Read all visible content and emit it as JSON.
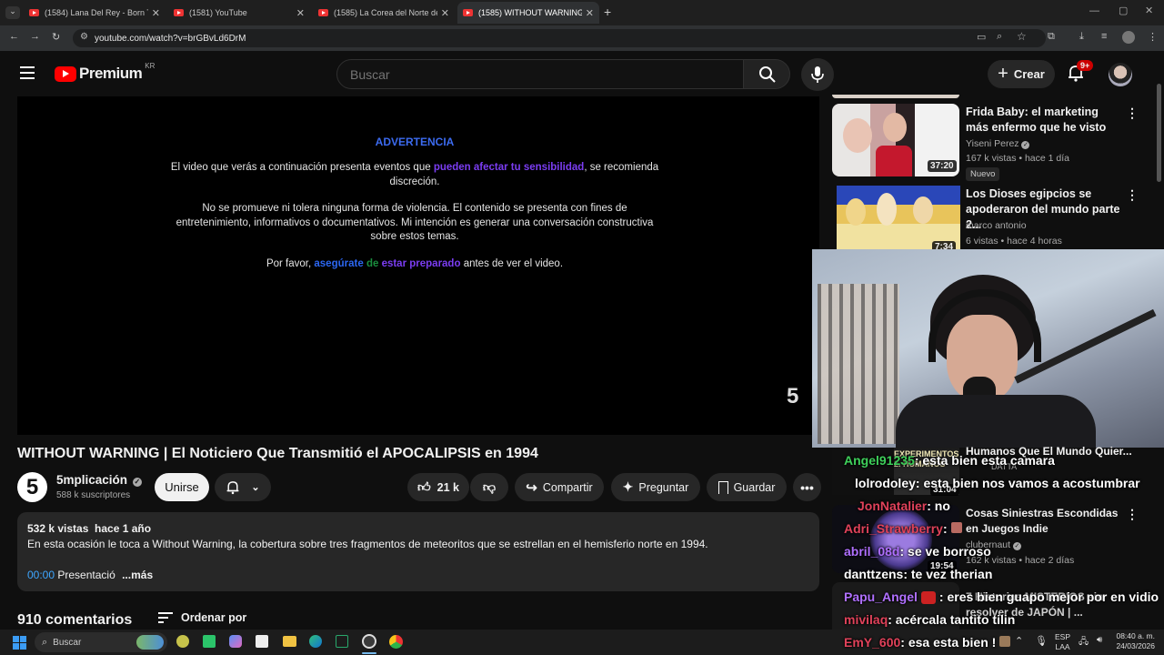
{
  "browser": {
    "tabs": [
      {
        "title": "(1584) Lana Del Rey - Born To Di"
      },
      {
        "title": "(1581) YouTube"
      },
      {
        "title": "(1585) La Corea del Norte de E"
      },
      {
        "title": "(1585) WITHOUT WARNING | E"
      }
    ],
    "url": "youtube.com/watch?v=brGBvLd6DrM"
  },
  "header": {
    "logo_text": "Premium",
    "region": "KR",
    "search_placeholder": "Buscar",
    "create_label": "Crear",
    "notif_badge": "9+"
  },
  "player": {
    "warning_title": "ADVERTENCIA",
    "p1a": "El video que verás a continuación presenta eventos que ",
    "p1b": "pueden afectar tu sensibilidad",
    "p1c": ", se recomienda",
    "p1d": "discreción.",
    "p2a": "No se promueve ni tolera ninguna forma de violencia.  El contenido se  presenta con fines de",
    "p2b": "entretenimiento, informativos o documentativos. Mi intención es generar una conversación constructiva",
    "p2c": "sobre estos temas.",
    "p3a": "Por favor, ",
    "p3b": "asegúrate",
    "p3c": "de",
    "p3d": "estar preparado",
    "p3e": " antes de ver el video.",
    "countdown": "5"
  },
  "video": {
    "title": "WITHOUT WARNING | El Noticiero Que Transmitió el APOCALIPSIS en 1994",
    "channel": "5mplicación",
    "subs": "588 k suscriptores",
    "join": "Unirse",
    "likes": "21 k",
    "share": "Compartir",
    "ask": "Preguntar",
    "save": "Guardar",
    "views_date": "532 k vistas  hace 1 año",
    "description": "En esta ocasión le toca a Without Warning, la cobertura sobre tres fragmentos de meteoritos que se estrellan en el hemisferio norte en 1994.",
    "chapter_time": "00:00",
    "chapter_name": "Presentació",
    "more": "...más",
    "comments": "910 comentarios",
    "sort": "Ordenar por"
  },
  "sidebar": [
    {
      "title": "Frida Baby: el marketing más enfermo que he visto",
      "channel": "Yiseni Perez",
      "meta": "167 k vistas • hace 1 día",
      "duration": "37:20",
      "badge": "Nuevo"
    },
    {
      "title": "Los Dioses egipcios  se apoderaron del mundo parte 2...",
      "channel": "marco antonio",
      "meta": "6 vistas • hace 4 horas",
      "duration": "7:34"
    },
    {
      "title": "Humanos Que El Mundo Quier...",
      "channel": "DATTA",
      "meta": "",
      "duration": "31:04",
      "thumb_text": "EXPERIMENTOS 2. HUMANOS"
    },
    {
      "title": "Cosas Siniestras Escondidas en Juegos Indie",
      "channel": "clubernaut",
      "meta": "162 k vistas • hace 2 días",
      "duration": "19:54"
    },
    {
      "title": "7 Historias MISTERIOS sin resolver de JAPÓN | ...",
      "channel": "",
      "meta": "",
      "duration": ""
    }
  ],
  "chat": [
    {
      "name": "Angel91235",
      "msg": ": esta bien esta camara",
      "color": "#3ecf5a"
    },
    {
      "name": "lolrodoley",
      "msg": ": esta bien nos vamos a acostumbrar",
      "color": "#ffffff"
    },
    {
      "name": "JonNatalier",
      "msg": ": no",
      "color": "#e0425a"
    },
    {
      "name": "Adri_Strawberry",
      "msg": ":",
      "color": "#e0425a"
    },
    {
      "name": "abril_08d",
      "msg": ": se ve borroso",
      "color": "#b070ff"
    },
    {
      "name": "danttzens",
      "msg": ": te vez therian",
      "color": "#ffffff"
    },
    {
      "name": "Papu_Angel",
      "msg": ": eres bien guapo mejor por en vidio",
      "color": "#b070ff"
    },
    {
      "name": "mivilaq",
      "msg": ": acércala tantito tilin",
      "color": "#e0425a"
    },
    {
      "name": "EmY_600",
      "msg": ": esa esta bien !",
      "color": "#e0425a"
    }
  ],
  "taskbar": {
    "search": "Buscar",
    "lang1": "ESP",
    "lang2": "LAA",
    "time": "08:40 a. m.",
    "date": "24/03/2026"
  }
}
